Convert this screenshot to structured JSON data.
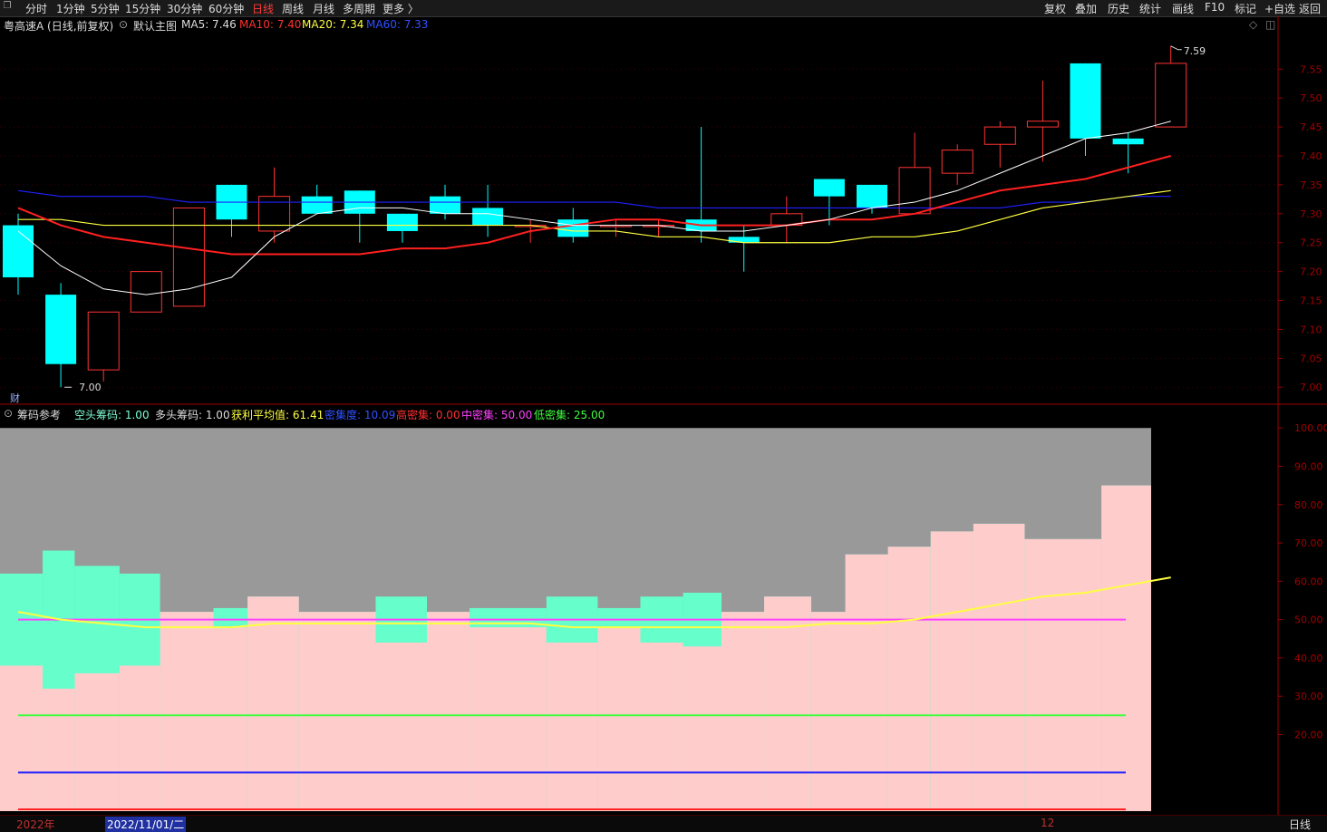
{
  "toolbar": {
    "periods": [
      "分时",
      "1分钟",
      "5分钟",
      "15分钟",
      "30分钟",
      "60分钟",
      "日线",
      "周线",
      "月线",
      "多周期",
      "更多 〉"
    ],
    "active_period": "日线",
    "right_buttons": [
      "复权",
      "叠加",
      "历史",
      "统计",
      "画线",
      "F10",
      "标记",
      "+自选",
      "返回"
    ]
  },
  "main_info": {
    "stock": "粤高速A (日线,前复权)",
    "template": "默认主图",
    "ma5": "MA5: 7.46",
    "ma10": "MA10: 7.40",
    "ma20": "MA20: 7.34",
    "ma60": "MA60: 7.33",
    "high_label": "7.59",
    "low_label": "7.00",
    "cai_label": "财"
  },
  "indicator_info": {
    "name": "筹码参考",
    "kong": "空头筹码: 1.00",
    "duo": "多头筹码: 1.00",
    "profit": "获利平均值: 61.41",
    "density": "密集度: 10.09",
    "high": "高密集: 0.00",
    "mid": "中密集: 50.00",
    "low": "低密集: 25.00"
  },
  "bottom": {
    "year": "2022年",
    "date": "2022/11/01/二",
    "month_mark": "12",
    "period": "日线"
  },
  "colors": {
    "up": "#ff3333",
    "down": "#00ffff",
    "ma5": "#ffffff",
    "ma10": "#ff2020",
    "ma20": "#ffff40",
    "ma60": "#2020ff",
    "axis": "#a00000"
  },
  "chart_data": [
    {
      "type": "candlestick",
      "y_ticks": [
        7.55,
        7.5,
        7.45,
        7.4,
        7.35,
        7.3,
        7.25,
        7.2,
        7.15,
        7.1,
        7.05,
        7.0
      ],
      "ylim": [
        6.98,
        7.61
      ],
      "candles": [
        {
          "o": 7.28,
          "c": 7.19,
          "h": 7.3,
          "l": 7.16
        },
        {
          "o": 7.16,
          "c": 7.04,
          "h": 7.18,
          "l": 7.0
        },
        {
          "o": 7.03,
          "c": 7.13,
          "h": 7.13,
          "l": 7.01
        },
        {
          "o": 7.13,
          "c": 7.2,
          "h": 7.2,
          "l": 7.13
        },
        {
          "o": 7.14,
          "c": 7.31,
          "h": 7.31,
          "l": 7.14
        },
        {
          "o": 7.35,
          "c": 7.29,
          "h": 7.35,
          "l": 7.26
        },
        {
          "o": 7.27,
          "c": 7.33,
          "h": 7.38,
          "l": 7.25
        },
        {
          "o": 7.33,
          "c": 7.3,
          "h": 7.35,
          "l": 7.3
        },
        {
          "o": 7.34,
          "c": 7.3,
          "h": 7.34,
          "l": 7.25
        },
        {
          "o": 7.3,
          "c": 7.27,
          "h": 7.3,
          "l": 7.25
        },
        {
          "o": 7.33,
          "c": 7.3,
          "h": 7.35,
          "l": 7.29
        },
        {
          "o": 7.31,
          "c": 7.28,
          "h": 7.35,
          "l": 7.26
        },
        {
          "o": 7.28,
          "c": 7.28,
          "h": 7.29,
          "l": 7.25
        },
        {
          "o": 7.29,
          "c": 7.26,
          "h": 7.31,
          "l": 7.25
        },
        {
          "o": 7.28,
          "c": 7.28,
          "h": 7.29,
          "l": 7.26
        },
        {
          "o": 7.28,
          "c": 7.28,
          "h": 7.29,
          "l": 7.26
        },
        {
          "o": 7.29,
          "c": 7.27,
          "h": 7.45,
          "l": 7.25
        },
        {
          "o": 7.26,
          "c": 7.25,
          "h": 7.28,
          "l": 7.2
        },
        {
          "o": 7.28,
          "c": 7.3,
          "h": 7.33,
          "l": 7.25
        },
        {
          "o": 7.36,
          "c": 7.33,
          "h": 7.36,
          "l": 7.28
        },
        {
          "o": 7.35,
          "c": 7.31,
          "h": 7.35,
          "l": 7.3
        },
        {
          "o": 7.3,
          "c": 7.38,
          "h": 7.44,
          "l": 7.3
        },
        {
          "o": 7.37,
          "c": 7.41,
          "h": 7.42,
          "l": 7.35
        },
        {
          "o": 7.42,
          "c": 7.45,
          "h": 7.46,
          "l": 7.38
        },
        {
          "o": 7.45,
          "c": 7.46,
          "h": 7.53,
          "l": 7.39
        },
        {
          "o": 7.56,
          "c": 7.43,
          "h": 7.56,
          "l": 7.4
        },
        {
          "o": 7.43,
          "c": 7.42,
          "h": 7.44,
          "l": 7.37
        },
        {
          "o": 7.45,
          "c": 7.56,
          "h": 7.59,
          "l": 7.45
        }
      ],
      "ma5": [
        7.27,
        7.21,
        7.17,
        7.16,
        7.17,
        7.19,
        7.26,
        7.3,
        7.31,
        7.31,
        7.3,
        7.3,
        7.29,
        7.28,
        7.28,
        7.28,
        7.27,
        7.27,
        7.28,
        7.29,
        7.31,
        7.32,
        7.34,
        7.37,
        7.4,
        7.43,
        7.44,
        7.46
      ],
      "ma10": [
        7.31,
        7.28,
        7.26,
        7.25,
        7.24,
        7.23,
        7.23,
        7.23,
        7.23,
        7.24,
        7.24,
        7.25,
        7.27,
        7.28,
        7.29,
        7.29,
        7.28,
        7.28,
        7.28,
        7.29,
        7.29,
        7.3,
        7.32,
        7.34,
        7.35,
        7.36,
        7.38,
        7.4
      ],
      "ma20": [
        7.29,
        7.29,
        7.28,
        7.28,
        7.28,
        7.28,
        7.28,
        7.28,
        7.28,
        7.28,
        7.28,
        7.28,
        7.28,
        7.27,
        7.27,
        7.26,
        7.26,
        7.25,
        7.25,
        7.25,
        7.26,
        7.26,
        7.27,
        7.29,
        7.31,
        7.32,
        7.33,
        7.34
      ],
      "ma60": [
        7.34,
        7.33,
        7.33,
        7.33,
        7.32,
        7.32,
        7.32,
        7.32,
        7.32,
        7.32,
        7.32,
        7.32,
        7.32,
        7.32,
        7.32,
        7.31,
        7.31,
        7.31,
        7.31,
        7.31,
        7.31,
        7.31,
        7.31,
        7.31,
        7.32,
        7.32,
        7.33,
        7.33
      ]
    },
    {
      "type": "area",
      "y_ticks": [
        100,
        90,
        80,
        70,
        60,
        50,
        40,
        30,
        20
      ],
      "ylim": [
        0,
        101
      ],
      "segments": [
        {
          "x0": 0,
          "x1": 1.0,
          "pink": 38,
          "teal": 62
        },
        {
          "x0": 1.0,
          "x1": 1.75,
          "pink": 32,
          "teal": 68
        },
        {
          "x0": 1.75,
          "x1": 2.8,
          "pink": 36,
          "teal": 64
        },
        {
          "x0": 2.8,
          "x1": 3.75,
          "pink": 38,
          "teal": 62
        },
        {
          "x0": 3.75,
          "x1": 5.0,
          "pink": 52,
          "teal": 52
        },
        {
          "x0": 5.0,
          "x1": 5.8,
          "pink": 48,
          "teal": 53
        },
        {
          "x0": 5.8,
          "x1": 7.0,
          "pink": 56,
          "teal": 56
        },
        {
          "x0": 7.0,
          "x1": 8.8,
          "pink": 52,
          "teal": 52
        },
        {
          "x0": 8.8,
          "x1": 10.0,
          "pink": 44,
          "teal": 56
        },
        {
          "x0": 10.0,
          "x1": 11.0,
          "pink": 52,
          "teal": 52
        },
        {
          "x0": 11.0,
          "x1": 12.8,
          "pink": 48,
          "teal": 53
        },
        {
          "x0": 12.8,
          "x1": 14.0,
          "pink": 44,
          "teal": 56
        },
        {
          "x0": 14.0,
          "x1": 15.0,
          "pink": 48,
          "teal": 53
        },
        {
          "x0": 15.0,
          "x1": 16.0,
          "pink": 44,
          "teal": 56
        },
        {
          "x0": 16.0,
          "x1": 16.9,
          "pink": 43,
          "teal": 57
        },
        {
          "x0": 16.9,
          "x1": 17.9,
          "pink": 52,
          "teal": 52
        },
        {
          "x0": 17.9,
          "x1": 19.0,
          "pink": 56,
          "teal": 56
        },
        {
          "x0": 19.0,
          "x1": 19.8,
          "pink": 52,
          "teal": 52
        },
        {
          "x0": 19.8,
          "x1": 20.8,
          "pink": 67,
          "teal": 67
        },
        {
          "x0": 20.8,
          "x1": 21.8,
          "pink": 69,
          "teal": 69
        },
        {
          "x0": 21.8,
          "x1": 22.8,
          "pink": 73,
          "teal": 73
        },
        {
          "x0": 22.8,
          "x1": 24.0,
          "pink": 75,
          "teal": 75
        },
        {
          "x0": 24.0,
          "x1": 25.8,
          "pink": 71,
          "teal": 71
        },
        {
          "x0": 25.8,
          "x1": 27.0,
          "pink": 85,
          "teal": 85
        }
      ],
      "profit_avg": [
        52,
        50,
        49,
        48,
        48,
        48,
        49,
        49,
        49,
        49,
        49,
        49,
        49,
        48,
        48,
        48,
        48,
        48,
        48,
        49,
        49,
        50,
        52,
        54,
        56,
        57,
        59,
        61
      ],
      "high_dense": 0,
      "mid_dense": 50,
      "low_dense": 25,
      "density": 10.09
    }
  ]
}
